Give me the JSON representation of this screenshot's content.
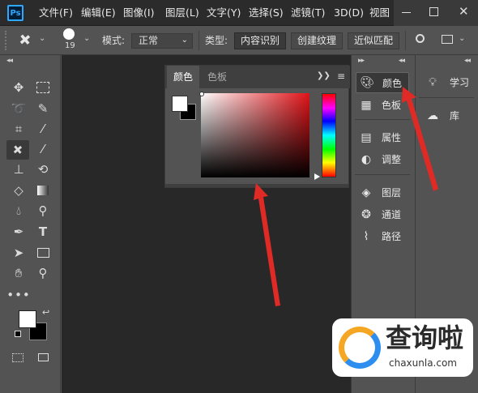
{
  "app": {
    "logo": "Ps"
  },
  "menu": [
    "文件(F)",
    "编辑(E)",
    "图像(I)",
    "图层(L)",
    "文字(Y)",
    "选择(S)",
    "滤镜(T)",
    "3D(D)",
    "视图"
  ],
  "options": {
    "brush_size": "19",
    "mode_label": "模式:",
    "mode_value": "正常",
    "type_label": "类型:",
    "type_buttons": [
      "内容识别",
      "创建纹理",
      "近似匹配"
    ]
  },
  "color_panel": {
    "tabs": [
      "颜色",
      "色板"
    ],
    "active_tab": "颜色",
    "selected_hue": "#e11318",
    "foreground": "#ffffff",
    "background": "#000000"
  },
  "right_panels": {
    "group1": [
      "颜色",
      "色板"
    ],
    "group2": [
      "属性",
      "调整"
    ],
    "group3": [
      "图层",
      "通道",
      "路径"
    ],
    "active": "颜色"
  },
  "far_right_panels": [
    "学习",
    "库"
  ],
  "watermark": {
    "title": "查询啦",
    "url": "chaxunla.com"
  },
  "colors": {
    "arrow": "#e02a25",
    "accent": "#31a8ff"
  }
}
